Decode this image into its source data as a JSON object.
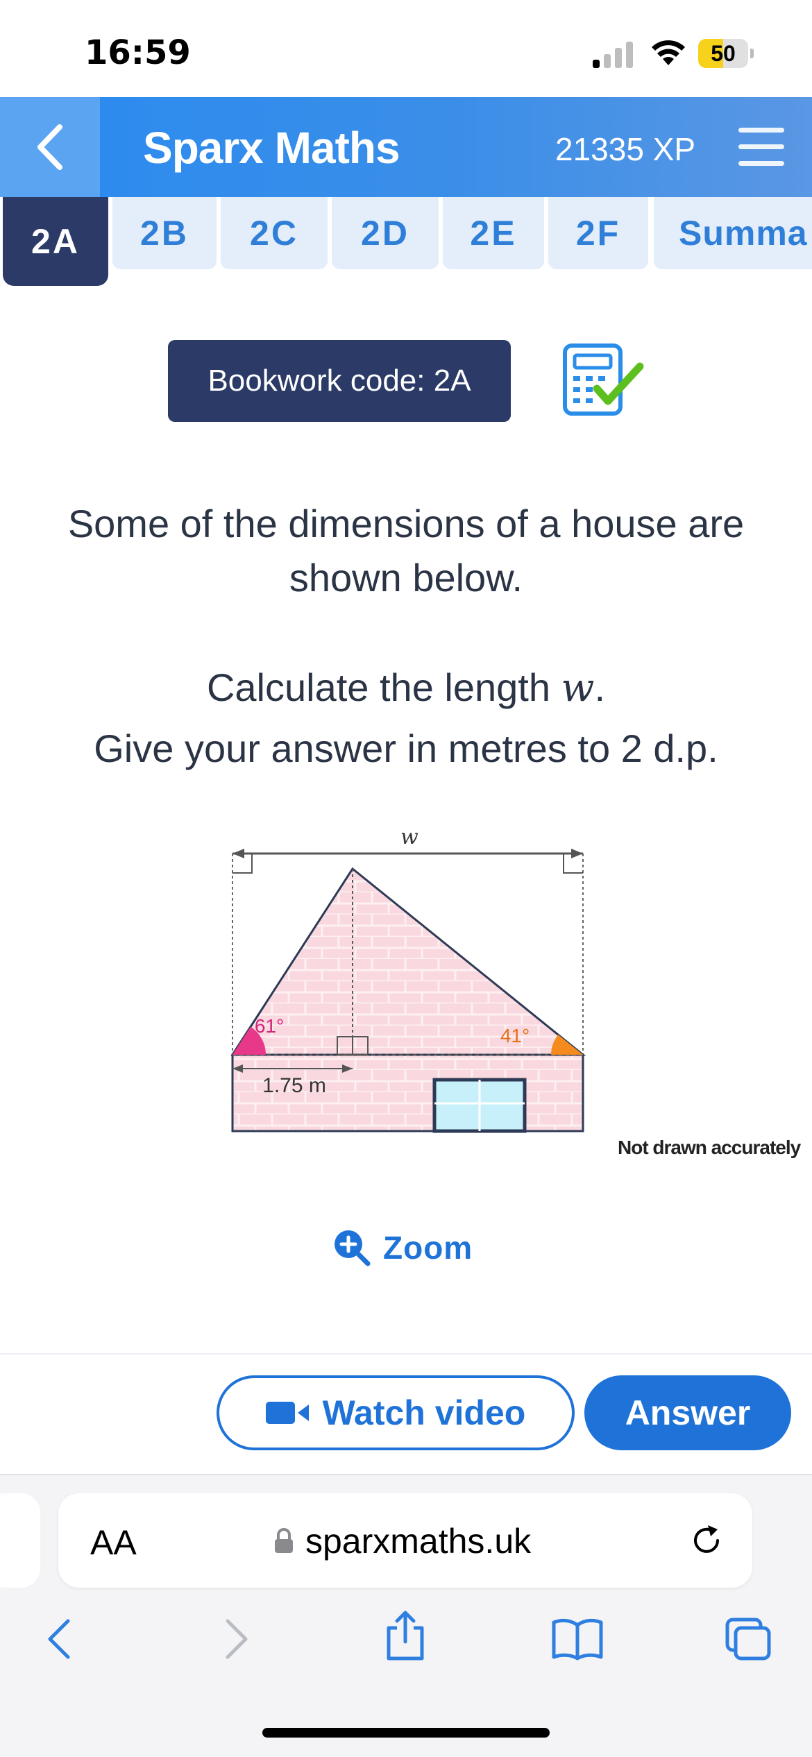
{
  "status_bar": {
    "time": "16:59",
    "battery": "50",
    "battery_level": 0.5
  },
  "header": {
    "title": "Sparx Maths",
    "xp": "21335 XP"
  },
  "tabs": [
    {
      "label": "2A",
      "active": true
    },
    {
      "label": "2B",
      "active": false
    },
    {
      "label": "2C",
      "active": false
    },
    {
      "label": "2D",
      "active": false
    },
    {
      "label": "2E",
      "active": false
    },
    {
      "label": "2F",
      "active": false
    },
    {
      "label": "Summa",
      "active": false
    }
  ],
  "bookwork": {
    "label": "Bookwork code: 2A"
  },
  "question": {
    "line1": "Some of the dimensions of a house are shown below.",
    "line2": "Calculate the length w.",
    "line3": "Give your answer in metres to 2 d.p."
  },
  "diagram": {
    "width_label": "w",
    "left_angle": "61°",
    "right_angle": "41°",
    "base_length": "1.75 m",
    "note": "Not drawn accurately",
    "colors": {
      "wall": "#f9d9df",
      "brick_line": "#ffffff",
      "left_angle": "#e8388a",
      "right_angle": "#f58a1f",
      "outline": "#2d3a56",
      "window": "#c8f0fb"
    }
  },
  "zoom": {
    "label": "Zoom"
  },
  "actions": {
    "watch_label": "Watch video",
    "answer_label": "Answer"
  },
  "browser": {
    "text_size": "AA",
    "url": "sparxmaths.uk"
  },
  "colors": {
    "primary": "#1f73d8",
    "navy": "#2b3a67",
    "tab_bg": "#e4eefa"
  }
}
